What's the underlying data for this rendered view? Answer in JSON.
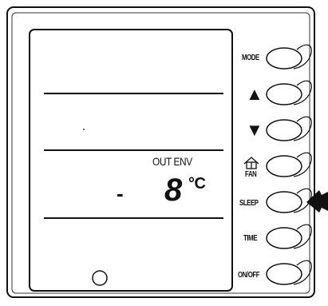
{
  "display": {
    "label": "OUT ENV",
    "dash": "-",
    "temperature": "8",
    "unit": "°C"
  },
  "buttons": {
    "mode": "MODE",
    "up": "▲",
    "down": "▼",
    "fan": "FAN",
    "sleep": "SLEEP",
    "time": "TIME",
    "onoff": "ON/OFF"
  }
}
